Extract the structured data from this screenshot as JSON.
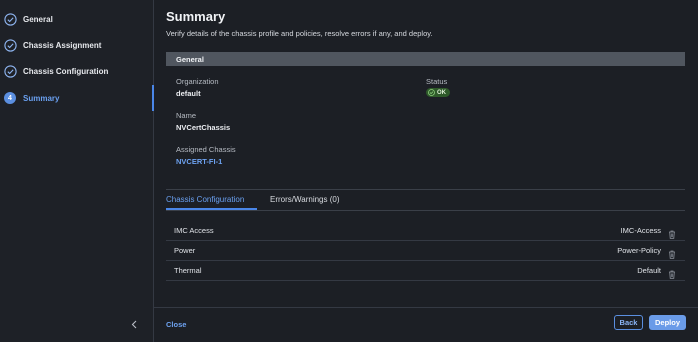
{
  "sidebar": {
    "steps": [
      {
        "label": "General",
        "state": "completed",
        "icon": "check-circle-icon"
      },
      {
        "label": "Chassis Assignment",
        "state": "completed",
        "icon": "check-circle-icon"
      },
      {
        "label": "Chassis Configuration",
        "state": "completed",
        "icon": "check-circle-icon"
      },
      {
        "label": "Summary",
        "state": "active",
        "number": "4"
      }
    ],
    "collapse_icon": "chevron-left-icon"
  },
  "main": {
    "title": "Summary",
    "subtitle": "Verify details of the chassis profile and policies, resolve errors if any, and deploy.",
    "general": {
      "header": "General",
      "organization_label": "Organization",
      "organization_value": "default",
      "status_label": "Status",
      "status_value": "OK",
      "name_label": "Name",
      "name_value": "NVCertChassis",
      "assigned_label": "Assigned Chassis",
      "assigned_value": "NVCERT-FI-1"
    },
    "tabs": [
      {
        "label": "Chassis Configuration",
        "active": true
      },
      {
        "label": "Errors/Warnings (0)",
        "active": false
      }
    ],
    "policies": [
      {
        "label": "IMC Access",
        "value": "IMC-Access"
      },
      {
        "label": "Power",
        "value": "Power-Policy"
      },
      {
        "label": "Thermal",
        "value": "Default"
      }
    ]
  },
  "footer": {
    "close_label": "Close",
    "back_label": "Back",
    "deploy_label": "Deploy"
  },
  "colors": {
    "accent": "#4a86e8",
    "background": "#1c1f25",
    "status_ok": "#2e5a2a"
  }
}
